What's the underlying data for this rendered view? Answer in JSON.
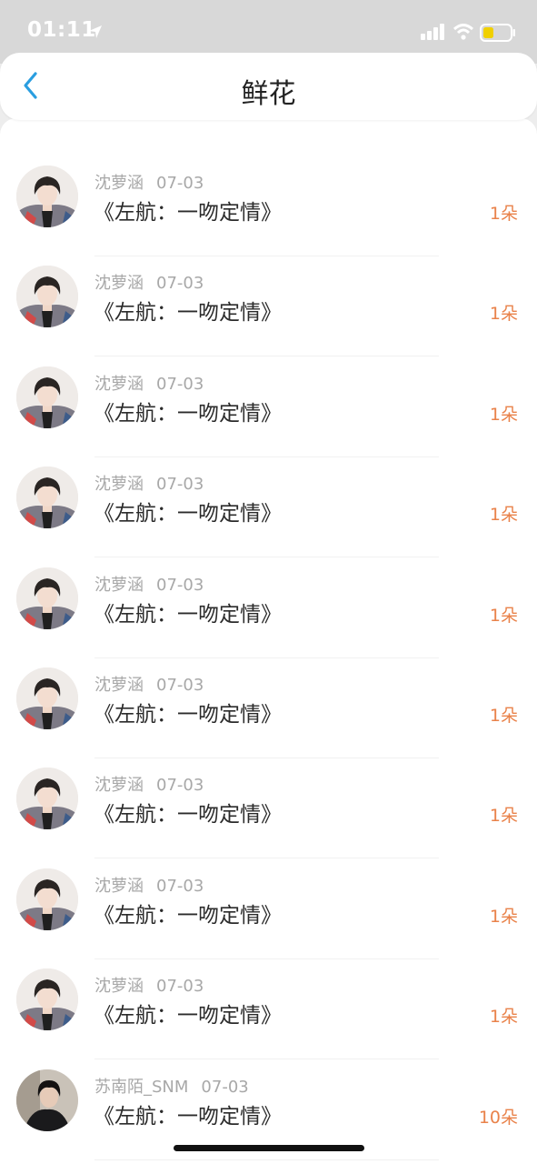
{
  "status_bar": {
    "time": "01:11",
    "icons": [
      "location-arrow-icon",
      "signal-icon",
      "wifi-icon",
      "battery-icon"
    ],
    "battery_color": "#f0d000"
  },
  "nav": {
    "back_icon": "chevron-left-icon",
    "title": "鲜花"
  },
  "colors": {
    "accent": "#e9824a",
    "back": "#2a9ee0",
    "meta_text": "#a8a8a8"
  },
  "rows": [
    {
      "user": "沈萝涵",
      "date": "07-03",
      "title": "《左航：一吻定情》",
      "count": "1朵"
    },
    {
      "user": "沈萝涵",
      "date": "07-03",
      "title": "《左航：一吻定情》",
      "count": "1朵"
    },
    {
      "user": "沈萝涵",
      "date": "07-03",
      "title": "《左航：一吻定情》",
      "count": "1朵"
    },
    {
      "user": "沈萝涵",
      "date": "07-03",
      "title": "《左航：一吻定情》",
      "count": "1朵"
    },
    {
      "user": "沈萝涵",
      "date": "07-03",
      "title": "《左航：一吻定情》",
      "count": "1朵"
    },
    {
      "user": "沈萝涵",
      "date": "07-03",
      "title": "《左航：一吻定情》",
      "count": "1朵"
    },
    {
      "user": "沈萝涵",
      "date": "07-03",
      "title": "《左航：一吻定情》",
      "count": "1朵"
    },
    {
      "user": "沈萝涵",
      "date": "07-03",
      "title": "《左航：一吻定情》",
      "count": "1朵"
    },
    {
      "user": "沈萝涵",
      "date": "07-03",
      "title": "《左航：一吻定情》",
      "count": "1朵"
    },
    {
      "user": "苏南陌_SNM",
      "date": "07-03",
      "title": "《左航：一吻定情》",
      "count": "10朵"
    }
  ]
}
